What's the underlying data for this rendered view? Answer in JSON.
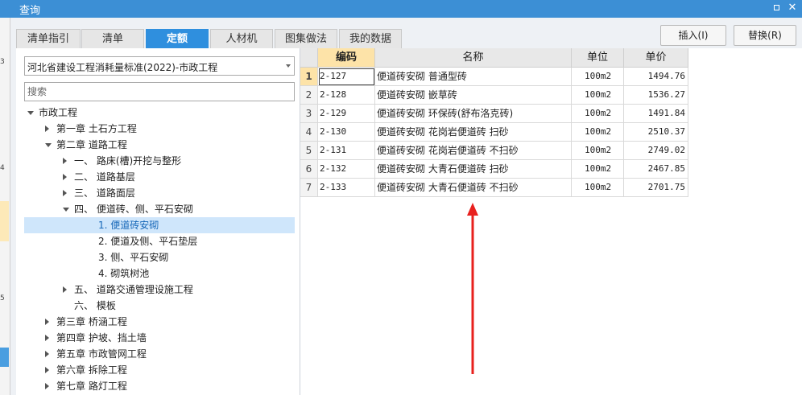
{
  "window": {
    "title": "查询"
  },
  "left_strip": {
    "marks": [
      "3",
      "4",
      "5"
    ]
  },
  "tabs": [
    {
      "label": "清单指引",
      "active": false
    },
    {
      "label": "清单",
      "active": false
    },
    {
      "label": "定额",
      "active": true
    },
    {
      "label": "人材机",
      "active": false
    },
    {
      "label": "图集做法",
      "active": false
    },
    {
      "label": "我的数据",
      "active": false
    }
  ],
  "buttons": {
    "insert": "插入(I)",
    "replace": "替换(R)"
  },
  "standard_select": {
    "value": "河北省建设工程消耗量标准(2022)-市政工程"
  },
  "search": {
    "placeholder": "搜索"
  },
  "tree": [
    {
      "label": "市政工程",
      "level": 0,
      "state": "expanded"
    },
    {
      "label": "第一章 土石方工程",
      "level": 1,
      "state": "collapsed"
    },
    {
      "label": "第二章 道路工程",
      "level": 1,
      "state": "expanded"
    },
    {
      "label": "一、 路床(槽)开挖与整形",
      "level": 2,
      "state": "collapsed"
    },
    {
      "label": "二、 道路基层",
      "level": 2,
      "state": "collapsed"
    },
    {
      "label": "三、 道路面层",
      "level": 2,
      "state": "collapsed"
    },
    {
      "label": "四、 便道砖、侧、平石安砌",
      "level": 2,
      "state": "expanded"
    },
    {
      "label": "1. 便道砖安砌",
      "level": 3,
      "state": "leaf",
      "selected": true
    },
    {
      "label": "2. 便道及侧、平石垫层",
      "level": 3,
      "state": "leaf"
    },
    {
      "label": "3. 侧、平石安砌",
      "level": 3,
      "state": "leaf"
    },
    {
      "label": "4. 砌筑树池",
      "level": 3,
      "state": "leaf"
    },
    {
      "label": "五、 道路交通管理设施工程",
      "level": 2,
      "state": "collapsed"
    },
    {
      "label": "六、 模板",
      "level": 2,
      "state": "leaf"
    },
    {
      "label": "第三章 桥涵工程",
      "level": 1,
      "state": "collapsed"
    },
    {
      "label": "第四章 护坡、挡土墙",
      "level": 1,
      "state": "collapsed"
    },
    {
      "label": "第五章 市政管网工程",
      "level": 1,
      "state": "collapsed"
    },
    {
      "label": "第六章 拆除工程",
      "level": 1,
      "state": "collapsed"
    },
    {
      "label": "第七章 路灯工程",
      "level": 1,
      "state": "collapsed"
    }
  ],
  "grid": {
    "columns": [
      "编码",
      "名称",
      "单位",
      "单价"
    ],
    "rows": [
      {
        "no": "1",
        "code": "2-127",
        "name": "便道砖安砌 普通型砖",
        "unit": "100m2",
        "price": "1494.76"
      },
      {
        "no": "2",
        "code": "2-128",
        "name": "便道砖安砌 嵌草砖",
        "unit": "100m2",
        "price": "1536.27"
      },
      {
        "no": "3",
        "code": "2-129",
        "name": "便道砖安砌 环保砖(舒布洛克砖)",
        "unit": "100m2",
        "price": "1491.84"
      },
      {
        "no": "4",
        "code": "2-130",
        "name": "便道砖安砌 花岗岩便道砖 扫砂",
        "unit": "100m2",
        "price": "2510.37"
      },
      {
        "no": "5",
        "code": "2-131",
        "name": "便道砖安砌 花岗岩便道砖 不扫砂",
        "unit": "100m2",
        "price": "2749.02"
      },
      {
        "no": "6",
        "code": "2-132",
        "name": "便道砖安砌 大青石便道砖 扫砂",
        "unit": "100m2",
        "price": "2467.85"
      },
      {
        "no": "7",
        "code": "2-133",
        "name": "便道砖安砌 大青石便道砖 不扫砂",
        "unit": "100m2",
        "price": "2701.75"
      }
    ]
  },
  "colors": {
    "title_bar": "#3c8fd5",
    "active_tab": "#2f8fde",
    "selected_header": "#fde3a8",
    "annotation_arrow": "#e8211e"
  }
}
